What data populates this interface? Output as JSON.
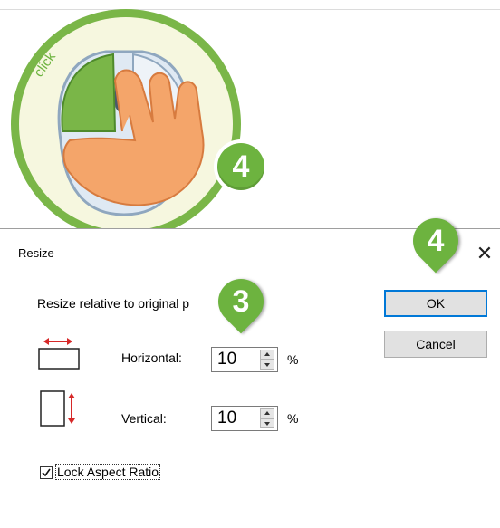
{
  "illustration": {
    "click_text": "click"
  },
  "callouts": {
    "mouse_step": "4",
    "input_step": "3",
    "ok_step": "4"
  },
  "dialog": {
    "title": "Resize",
    "close_glyph": "✕",
    "instruction": "Resize relative to original p",
    "ok_label": "OK",
    "cancel_label": "Cancel",
    "horizontal_label": "Horizontal:",
    "horizontal_value": "10",
    "vertical_label": "Vertical:",
    "vertical_value": "10",
    "unit": "%",
    "lock_label": "Lock Aspect Ratio",
    "lock_checked": true
  },
  "icons": {
    "horizontal_resize": "horizontal-resize-icon",
    "vertical_resize": "vertical-resize-icon"
  },
  "colors": {
    "accent_green": "#6db33f",
    "arrow_red": "#d62828",
    "focus_blue": "#0078d7"
  }
}
